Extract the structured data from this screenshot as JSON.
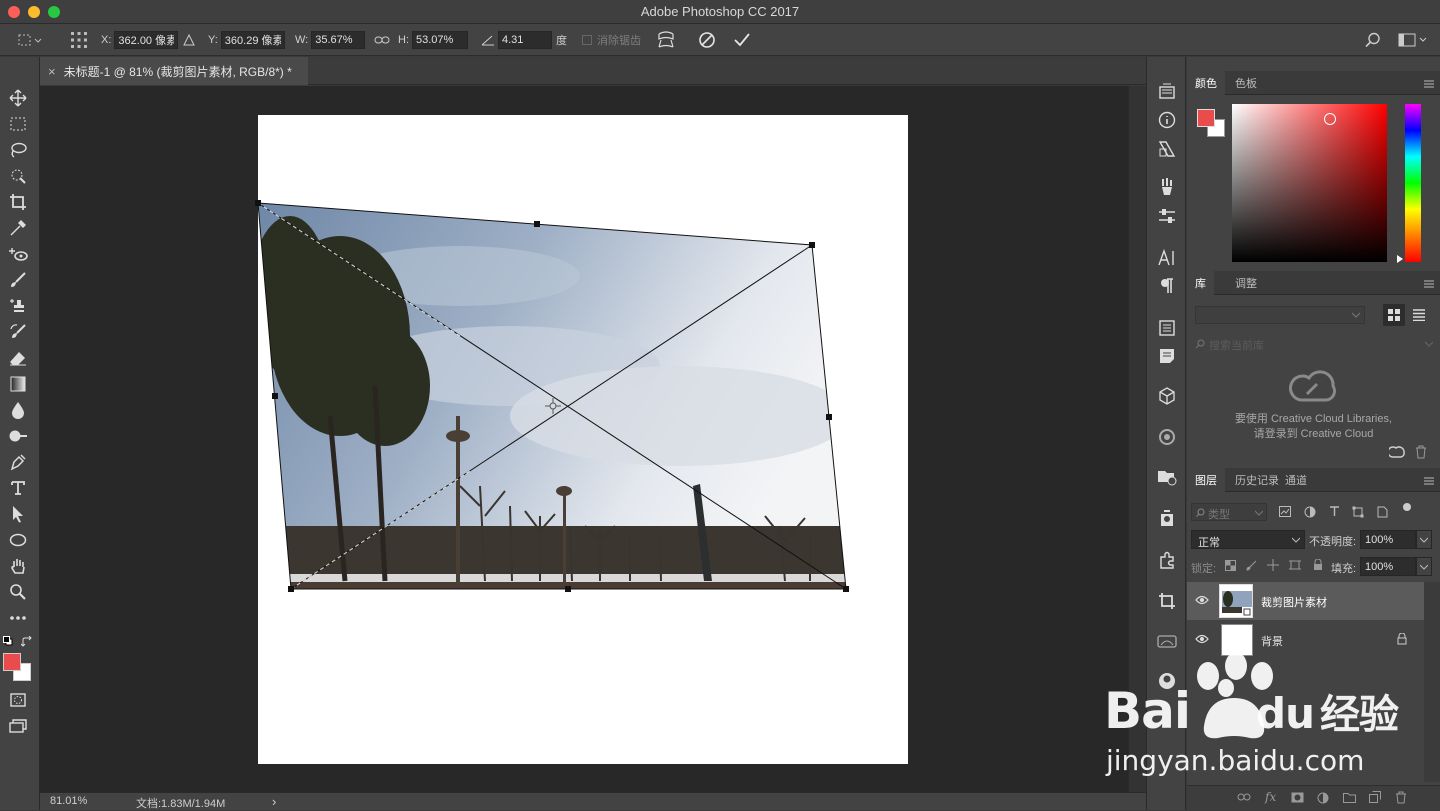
{
  "app": {
    "title": "Adobe Photoshop CC 2017"
  },
  "options": {
    "x_label": "X:",
    "x_value": "362.00 像素",
    "y_label": "Y:",
    "y_value": "360.29 像素",
    "w_label": "W:",
    "w_value": "35.67%",
    "h_label": "H:",
    "h_value": "53.07%",
    "angle_value": "4.31",
    "angle_unit": "度",
    "antialias_label": "消除锯齿"
  },
  "document": {
    "tab_label": "未标题-1 @ 81% (裁剪图片素材, RGB/8*) *",
    "close_glyph": "×"
  },
  "status": {
    "zoom": "81.01%",
    "doc_info": "文档:1.83M/1.94M",
    "arrow": "›"
  },
  "color_panel": {
    "tabs": [
      "颜色",
      "色板"
    ],
    "foreground": "#e84c4c",
    "background": "#ffffff"
  },
  "library_panel": {
    "tabs": [
      "库",
      "调整"
    ],
    "search_placeholder": "搜索当前库",
    "message_line1": "要使用 Creative Cloud Libraries,",
    "message_line2": "请登录到 Creative Cloud"
  },
  "layers_panel": {
    "tabs": [
      "图层",
      "历史记录",
      "通道"
    ],
    "filter_label": "类型",
    "blend_mode": "正常",
    "opacity_label": "不透明度:",
    "opacity_value": "100%",
    "lock_label": "锁定:",
    "fill_label": "填充:",
    "fill_value": "100%",
    "layers": [
      {
        "name": "裁剪图片素材",
        "selected": true
      },
      {
        "name": "背景",
        "selected": false
      }
    ]
  },
  "watermark": {
    "brand_a": "Bai",
    "brand_b": "du",
    "brand_c": "经验",
    "url": "jingyan.baidu.com"
  }
}
